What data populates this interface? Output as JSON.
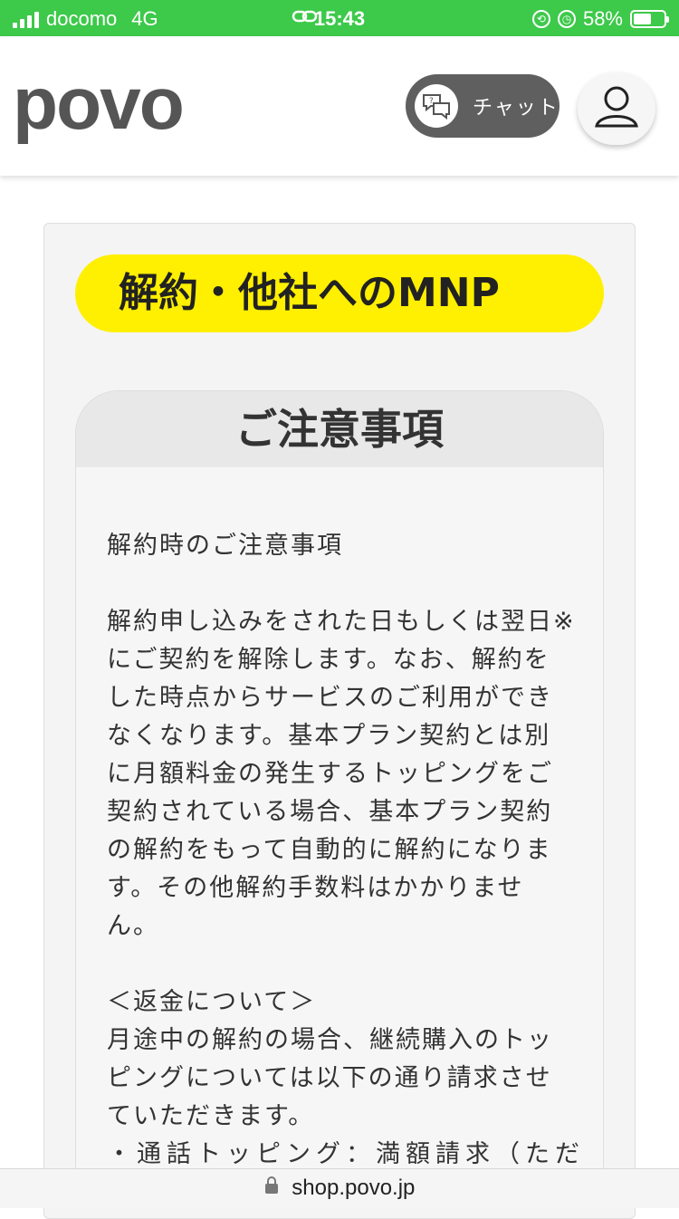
{
  "status_bar": {
    "carrier": "docomo",
    "network": "4G",
    "time": "15:43",
    "battery": "58%",
    "battery_level": 0.58,
    "bg_color": "#3dc94a"
  },
  "header": {
    "logo": "povo",
    "chat_label": "チャット",
    "chat_icon": "chat-help-icon",
    "account_icon": "person-icon"
  },
  "page": {
    "title": "解約・他社へのMNP",
    "title_bg": "#ffef00"
  },
  "notice": {
    "heading": "ご注意事項",
    "subheading": "解約時のご注意事項",
    "paragraph1": "解約申し込みをされた日もしくは翌日※にご契約を解除します。なお、解約をした時点からサービスのご利用ができなくなります。基本プラン契約とは別に月額料金の発生するトッピングをご契約されている場合、基本プラン契約の解約をもって自動的に解約になります。その他解約手数料はかかりません。",
    "refund_heading": "＜返金について＞",
    "refund_text": "月途中の解約の場合、継続購入のトッピングについては以下の通り請求させていただきます。",
    "refund_item1": "・通話トッピング：満額請求（ただ"
  },
  "url_bar": {
    "url": "shop.povo.jp",
    "lock_icon": "lock-icon"
  }
}
